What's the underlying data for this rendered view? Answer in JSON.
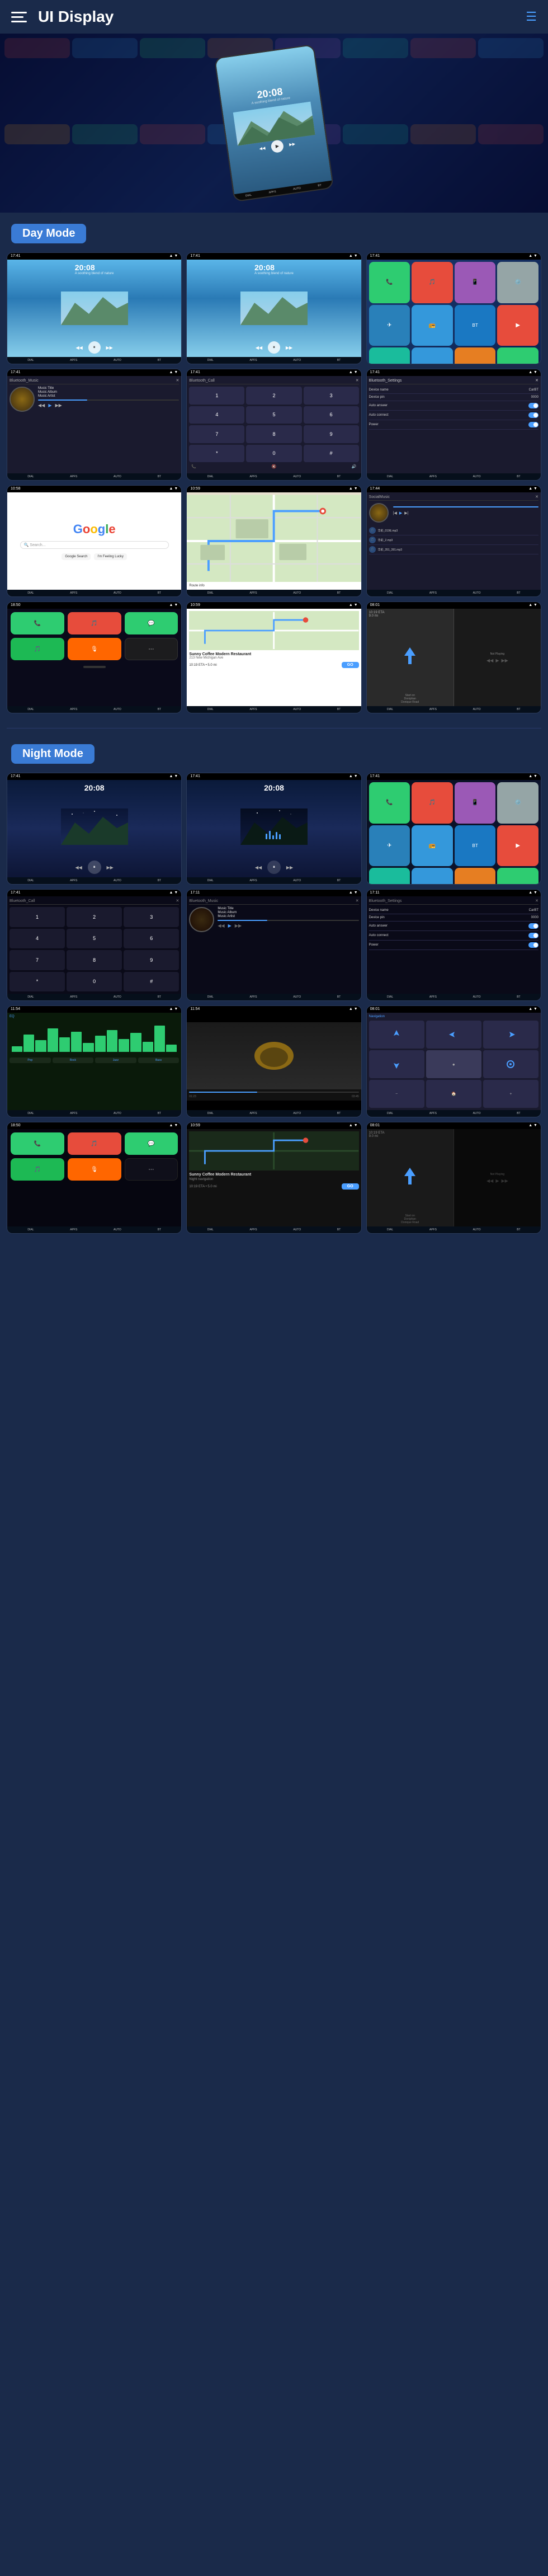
{
  "header": {
    "title": "UI Display",
    "menu_icon": "≡",
    "hamburger_icon": "☰"
  },
  "hero": {
    "time": "20:08",
    "subtitle": "A soothing blend of nature"
  },
  "sections": {
    "day_mode": "Day Mode",
    "night_mode": "Night Mode"
  },
  "day_screenshots": [
    {
      "type": "music",
      "time": "20:08",
      "subtitle": "A soothing blend of nature"
    },
    {
      "type": "music",
      "time": "20:08",
      "subtitle": "A soothing blend of nature"
    },
    {
      "type": "apps",
      "label": "App Grid"
    },
    {
      "type": "bluetooth_music",
      "header": "Bluetooth_Music",
      "track": "Music Title",
      "album": "Music Album",
      "artist": "Music Artist"
    },
    {
      "type": "bluetooth_call",
      "header": "Bluetooth_Call"
    },
    {
      "type": "bluetooth_settings",
      "header": "Bluetooth_Settings",
      "fields": [
        {
          "label": "Device name",
          "value": "CarBT"
        },
        {
          "label": "Device pin",
          "value": "0000"
        },
        {
          "label": "Auto answer",
          "value": "toggle"
        },
        {
          "label": "Auto connect",
          "value": "toggle"
        },
        {
          "label": "Power",
          "value": "toggle"
        }
      ]
    },
    {
      "type": "google",
      "logo": "Google"
    },
    {
      "type": "map",
      "label": "Navigation Map"
    },
    {
      "type": "local_music",
      "header": "SocialMusic",
      "tracks": [
        "华彩_019E.mp3",
        "华彩_2.mp3",
        "华彩_351_391.mp3"
      ]
    },
    {
      "type": "carplay_apps",
      "label": "CarPlay Apps"
    },
    {
      "type": "sunny_coffee",
      "name": "Sunny Coffee Modern Restaurant",
      "address": "213 New Michigan Ave",
      "eta": "10:19 ETA",
      "distance": "5.0 mi",
      "action": "GO"
    },
    {
      "type": "nav_turn",
      "label": "Navigation Turn",
      "eta": "10:19 ETA",
      "distance": "9.0 mi",
      "not_playing": "Not Playing"
    }
  ],
  "night_screenshots": [
    {
      "type": "music_night",
      "time": "20:08"
    },
    {
      "type": "music_night",
      "time": "20:08"
    },
    {
      "type": "apps_night"
    },
    {
      "type": "bluetooth_call_night",
      "header": "Bluetooth_Call"
    },
    {
      "type": "bluetooth_music_night",
      "header": "Bluetooth_Music",
      "track": "Music Title",
      "album": "Music Album",
      "artist": "Music Artist"
    },
    {
      "type": "bluetooth_settings_night",
      "header": "Bluetooth_Settings",
      "fields": [
        {
          "label": "Device name",
          "value": "CarBT"
        },
        {
          "label": "Device pin",
          "value": "0000"
        },
        {
          "label": "Auto answer",
          "value": "toggle"
        },
        {
          "label": "Auto connect",
          "value": "toggle"
        },
        {
          "label": "Power",
          "value": "toggle"
        }
      ]
    },
    {
      "type": "eq_night",
      "label": "Equalizer"
    },
    {
      "type": "video_night",
      "label": "Video"
    },
    {
      "type": "nav_night",
      "label": "Night Navigation"
    },
    {
      "type": "carplay_apps_night"
    },
    {
      "type": "sunny_coffee_night",
      "name": "Sunny Coffee Modern Restaurant",
      "action": "GO"
    },
    {
      "type": "nav_turn_night",
      "not_playing": "Not Playing"
    }
  ],
  "bottom_bar": {
    "items": [
      "DIAL",
      "APFS",
      "AUTO",
      "BT"
    ]
  }
}
